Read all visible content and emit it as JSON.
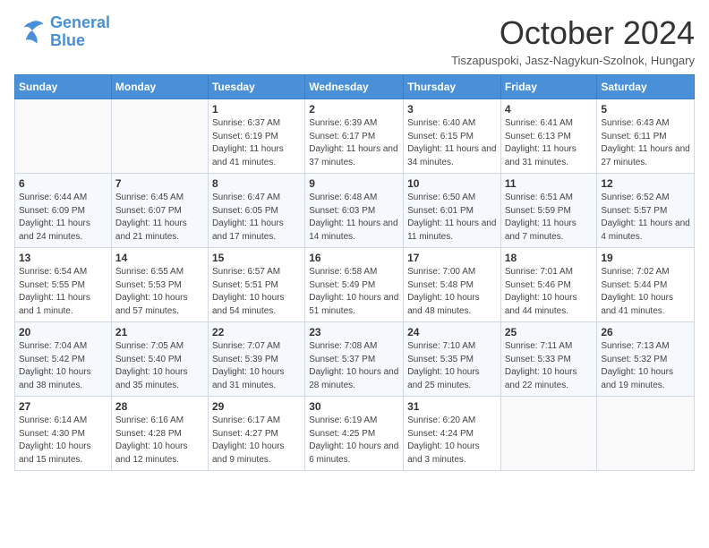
{
  "logo": {
    "line1": "General",
    "line2": "Blue"
  },
  "title": "October 2024",
  "subtitle": "Tiszapuspoki, Jasz-Nagykun-Szolnok, Hungary",
  "days_of_week": [
    "Sunday",
    "Monday",
    "Tuesday",
    "Wednesday",
    "Thursday",
    "Friday",
    "Saturday"
  ],
  "weeks": [
    [
      {
        "day": "",
        "info": ""
      },
      {
        "day": "",
        "info": ""
      },
      {
        "day": "1",
        "info": "Sunrise: 6:37 AM\nSunset: 6:19 PM\nDaylight: 11 hours and 41 minutes."
      },
      {
        "day": "2",
        "info": "Sunrise: 6:39 AM\nSunset: 6:17 PM\nDaylight: 11 hours and 37 minutes."
      },
      {
        "day": "3",
        "info": "Sunrise: 6:40 AM\nSunset: 6:15 PM\nDaylight: 11 hours and 34 minutes."
      },
      {
        "day": "4",
        "info": "Sunrise: 6:41 AM\nSunset: 6:13 PM\nDaylight: 11 hours and 31 minutes."
      },
      {
        "day": "5",
        "info": "Sunrise: 6:43 AM\nSunset: 6:11 PM\nDaylight: 11 hours and 27 minutes."
      }
    ],
    [
      {
        "day": "6",
        "info": "Sunrise: 6:44 AM\nSunset: 6:09 PM\nDaylight: 11 hours and 24 minutes."
      },
      {
        "day": "7",
        "info": "Sunrise: 6:45 AM\nSunset: 6:07 PM\nDaylight: 11 hours and 21 minutes."
      },
      {
        "day": "8",
        "info": "Sunrise: 6:47 AM\nSunset: 6:05 PM\nDaylight: 11 hours and 17 minutes."
      },
      {
        "day": "9",
        "info": "Sunrise: 6:48 AM\nSunset: 6:03 PM\nDaylight: 11 hours and 14 minutes."
      },
      {
        "day": "10",
        "info": "Sunrise: 6:50 AM\nSunset: 6:01 PM\nDaylight: 11 hours and 11 minutes."
      },
      {
        "day": "11",
        "info": "Sunrise: 6:51 AM\nSunset: 5:59 PM\nDaylight: 11 hours and 7 minutes."
      },
      {
        "day": "12",
        "info": "Sunrise: 6:52 AM\nSunset: 5:57 PM\nDaylight: 11 hours and 4 minutes."
      }
    ],
    [
      {
        "day": "13",
        "info": "Sunrise: 6:54 AM\nSunset: 5:55 PM\nDaylight: 11 hours and 1 minute."
      },
      {
        "day": "14",
        "info": "Sunrise: 6:55 AM\nSunset: 5:53 PM\nDaylight: 10 hours and 57 minutes."
      },
      {
        "day": "15",
        "info": "Sunrise: 6:57 AM\nSunset: 5:51 PM\nDaylight: 10 hours and 54 minutes."
      },
      {
        "day": "16",
        "info": "Sunrise: 6:58 AM\nSunset: 5:49 PM\nDaylight: 10 hours and 51 minutes."
      },
      {
        "day": "17",
        "info": "Sunrise: 7:00 AM\nSunset: 5:48 PM\nDaylight: 10 hours and 48 minutes."
      },
      {
        "day": "18",
        "info": "Sunrise: 7:01 AM\nSunset: 5:46 PM\nDaylight: 10 hours and 44 minutes."
      },
      {
        "day": "19",
        "info": "Sunrise: 7:02 AM\nSunset: 5:44 PM\nDaylight: 10 hours and 41 minutes."
      }
    ],
    [
      {
        "day": "20",
        "info": "Sunrise: 7:04 AM\nSunset: 5:42 PM\nDaylight: 10 hours and 38 minutes."
      },
      {
        "day": "21",
        "info": "Sunrise: 7:05 AM\nSunset: 5:40 PM\nDaylight: 10 hours and 35 minutes."
      },
      {
        "day": "22",
        "info": "Sunrise: 7:07 AM\nSunset: 5:39 PM\nDaylight: 10 hours and 31 minutes."
      },
      {
        "day": "23",
        "info": "Sunrise: 7:08 AM\nSunset: 5:37 PM\nDaylight: 10 hours and 28 minutes."
      },
      {
        "day": "24",
        "info": "Sunrise: 7:10 AM\nSunset: 5:35 PM\nDaylight: 10 hours and 25 minutes."
      },
      {
        "day": "25",
        "info": "Sunrise: 7:11 AM\nSunset: 5:33 PM\nDaylight: 10 hours and 22 minutes."
      },
      {
        "day": "26",
        "info": "Sunrise: 7:13 AM\nSunset: 5:32 PM\nDaylight: 10 hours and 19 minutes."
      }
    ],
    [
      {
        "day": "27",
        "info": "Sunrise: 6:14 AM\nSunset: 4:30 PM\nDaylight: 10 hours and 15 minutes."
      },
      {
        "day": "28",
        "info": "Sunrise: 6:16 AM\nSunset: 4:28 PM\nDaylight: 10 hours and 12 minutes."
      },
      {
        "day": "29",
        "info": "Sunrise: 6:17 AM\nSunset: 4:27 PM\nDaylight: 10 hours and 9 minutes."
      },
      {
        "day": "30",
        "info": "Sunrise: 6:19 AM\nSunset: 4:25 PM\nDaylight: 10 hours and 6 minutes."
      },
      {
        "day": "31",
        "info": "Sunrise: 6:20 AM\nSunset: 4:24 PM\nDaylight: 10 hours and 3 minutes."
      },
      {
        "day": "",
        "info": ""
      },
      {
        "day": "",
        "info": ""
      }
    ]
  ]
}
